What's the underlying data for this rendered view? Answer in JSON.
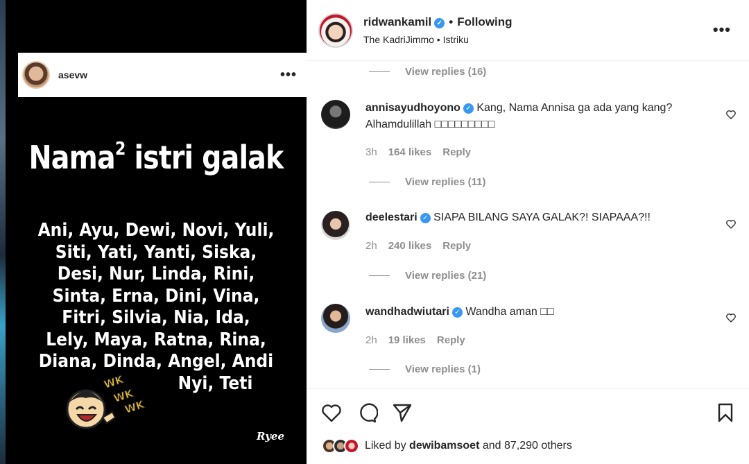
{
  "post_media": {
    "username": "asevw",
    "title_main": "Nama",
    "title_sup": "2",
    "title_rest": " istri galak",
    "names_lines": [
      "Ani, Ayu, Dewi, Novi, Yuli,",
      "Siti, Yati, Yanti, Siska,",
      "Desi, Nur, Linda, Rini,",
      "Sinta, Erna, Dini, Vina,",
      "Fitri, Silvia, Nia, Ida,",
      "Lely, Maya, Ratna, Rina,",
      "Diana, Dinda, Angel, Andi"
    ],
    "names_last_line": "Nyi, Teti",
    "sticker_text": [
      "WK",
      "WK",
      "WK"
    ],
    "signature": "Ryee"
  },
  "header": {
    "username": "ridwankamil",
    "follow_status": "Following",
    "audio_artist": "The KadriJimmo",
    "audio_title": "Istriku"
  },
  "comments_top_reply": "View replies (16)",
  "comments": [
    {
      "username": "annisayudhoyono",
      "text": "Kang, Nama Annisa ga ada yang kang? Alhamdulillah □□□□□□□□□",
      "time": "3h",
      "likes": "164 likes",
      "reply": "Reply",
      "view_replies": "View replies (11)"
    },
    {
      "username": "deelestari",
      "text": "SIAPA BILANG SAYA GALAK?! SIAPAAA?!!",
      "time": "2h",
      "likes": "240 likes",
      "reply": "Reply",
      "view_replies": "View replies (21)"
    },
    {
      "username": "wandhadwiutari",
      "text": "Wandha aman □□",
      "time": "2h",
      "likes": "19 likes",
      "reply": "Reply",
      "view_replies": "View replies (1)"
    }
  ],
  "likes_bar": {
    "prefix": "Liked by",
    "liker": "dewibamsoet",
    "suffix": "and 87,290 others"
  },
  "icons": {
    "like": "heart-icon",
    "comment": "comment-icon",
    "share": "share-icon",
    "save": "bookmark-icon",
    "more": "more-icon",
    "verified": "verified-badge-icon"
  },
  "colors": {
    "verified": "#3897f0",
    "muted": "#8e8e8e",
    "text": "#262626"
  }
}
